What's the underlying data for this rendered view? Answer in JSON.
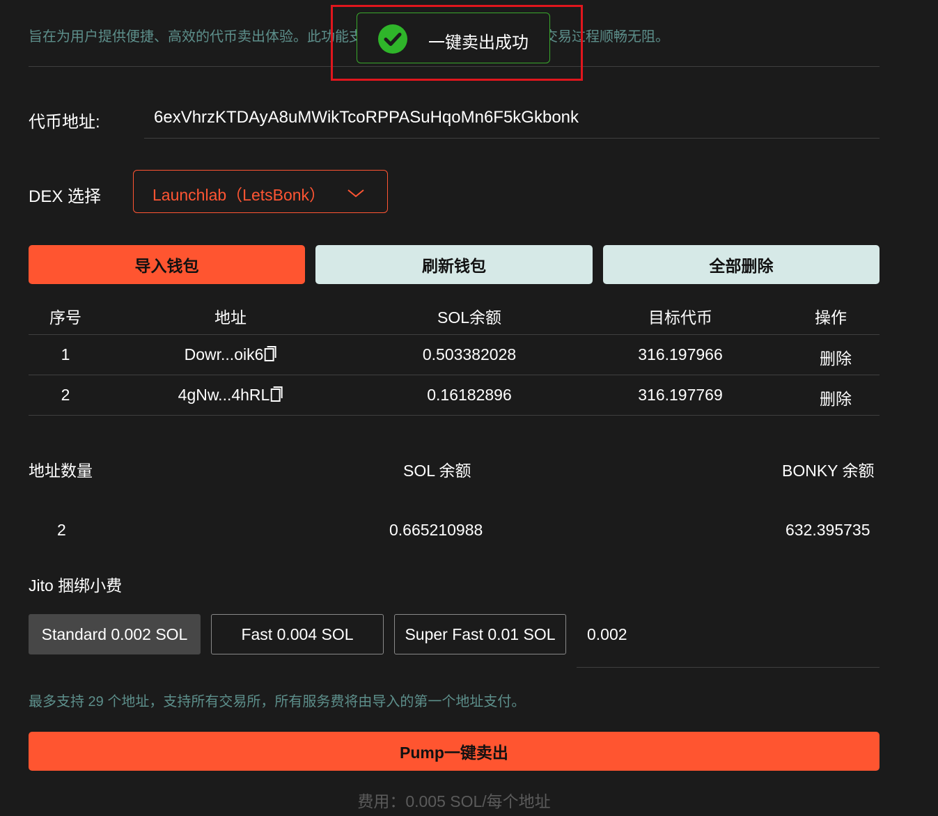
{
  "intro_text": "旨在为用户提供便捷、高效的代币卖出体验。此功能支持多地址批量捆绑卖出，确保交易过程顺畅无阻。",
  "toast": {
    "message": "一键卖出成功",
    "icon": "check-circle-icon",
    "color": "#2fb52a"
  },
  "token": {
    "label": "代币地址:",
    "value": "6exVhrzKTDAyA8uMWikTcoRPPASuHqoMn6F5kGkbonk"
  },
  "dex": {
    "label": "DEX 选择",
    "selected": "Launchlab（LetsBonk）",
    "icon": "chevron-down-icon"
  },
  "actions": {
    "import": "导入钱包",
    "refresh": "刷新钱包",
    "delete_all": "全部删除"
  },
  "table": {
    "headers": [
      "序号",
      "地址",
      "SOL余额",
      "目标代币",
      "操作"
    ],
    "rows": [
      {
        "index": "1",
        "address": "Dowr...oik6",
        "sol": "0.503382028",
        "target": "316.197966",
        "action": "删除"
      },
      {
        "index": "2",
        "address": "4gNw...4hRL",
        "sol": "0.16182896",
        "target": "316.197769",
        "action": "删除"
      }
    ]
  },
  "summary": {
    "count_label": "地址数量",
    "count_value": "2",
    "sol_label": "SOL 余额",
    "sol_value": "0.665210988",
    "token_label": "BONKY 余额",
    "token_value": "632.395735"
  },
  "jito": {
    "label": "Jito 捆绑小费",
    "options": [
      "Standard 0.002 SOL",
      "Fast 0.004 SOL",
      "Super Fast 0.01 SOL"
    ],
    "selected_index": 0,
    "custom_value": "0.002"
  },
  "note": "最多支持 29 个地址，支持所有交易所，所有服务费将由导入的第一个地址支付。",
  "submit_label": "Pump一键卖出",
  "fee_text": "费用：0.005 SOL/每个地址",
  "colors": {
    "accent": "#ff5530",
    "muted_teal": "#5d8f8b",
    "background": "#1b1b1b"
  }
}
